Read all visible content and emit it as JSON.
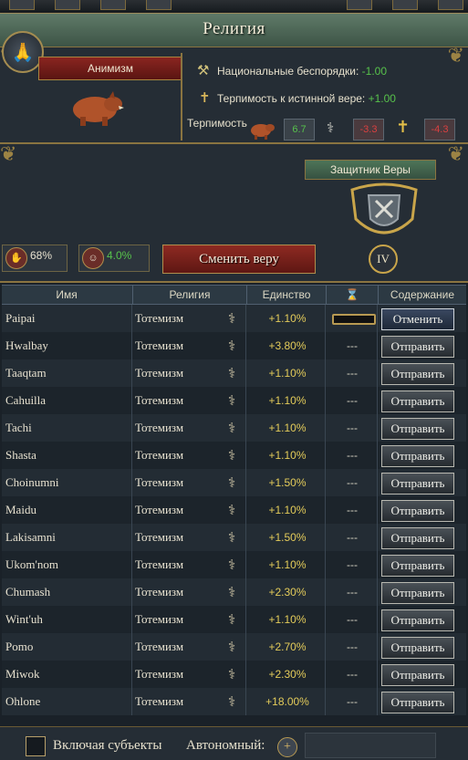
{
  "window": {
    "title": "Религия"
  },
  "religion": {
    "name": "Анимизм",
    "national_unrest_label": "Национальные беспорядки:",
    "national_unrest_value": "-1.00",
    "true_faith_tolerance_label": "Терпимость к истинной вере:",
    "true_faith_tolerance_value": "+1.00",
    "tolerance_label": "Терпимость",
    "tolerance_values": [
      "6.7",
      "-3.3",
      "-4.3"
    ]
  },
  "defender": {
    "label": "Защитник Веры",
    "rank": "IV"
  },
  "stats": {
    "percent_a": "68%",
    "percent_b": "4.0%"
  },
  "change_button": "Сменить веру",
  "table": {
    "headers": [
      "Имя",
      "Религия",
      "Единство",
      "⌛",
      "Содержание"
    ],
    "rows": [
      {
        "name": "Paipai",
        "religion": "Тотемизм",
        "unity": "+1.10%",
        "status": "bar",
        "action": "Отменить"
      },
      {
        "name": "Hwalbay",
        "religion": "Тотемизм",
        "unity": "+3.80%",
        "status": "---",
        "action": "Отправить"
      },
      {
        "name": "Taaqtam",
        "religion": "Тотемизм",
        "unity": "+1.10%",
        "status": "---",
        "action": "Отправить"
      },
      {
        "name": "Cahuilla",
        "religion": "Тотемизм",
        "unity": "+1.10%",
        "status": "---",
        "action": "Отправить"
      },
      {
        "name": "Tachi",
        "religion": "Тотемизм",
        "unity": "+1.10%",
        "status": "---",
        "action": "Отправить"
      },
      {
        "name": "Shasta",
        "religion": "Тотемизм",
        "unity": "+1.10%",
        "status": "---",
        "action": "Отправить"
      },
      {
        "name": "Choinumni",
        "religion": "Тотемизм",
        "unity": "+1.50%",
        "status": "---",
        "action": "Отправить"
      },
      {
        "name": "Maidu",
        "religion": "Тотемизм",
        "unity": "+1.10%",
        "status": "---",
        "action": "Отправить"
      },
      {
        "name": "Lakisamni",
        "religion": "Тотемизм",
        "unity": "+1.50%",
        "status": "---",
        "action": "Отправить"
      },
      {
        "name": "Ukom'nom",
        "religion": "Тотемизм",
        "unity": "+1.10%",
        "status": "---",
        "action": "Отправить"
      },
      {
        "name": "Chumash",
        "religion": "Тотемизм",
        "unity": "+2.30%",
        "status": "---",
        "action": "Отправить"
      },
      {
        "name": "Wint'uh",
        "religion": "Тотемизм",
        "unity": "+1.10%",
        "status": "---",
        "action": "Отправить"
      },
      {
        "name": "Pomo",
        "religion": "Тотемизм",
        "unity": "+2.70%",
        "status": "---",
        "action": "Отправить"
      },
      {
        "name": "Miwok",
        "religion": "Тотемизм",
        "unity": "+2.30%",
        "status": "---",
        "action": "Отправить"
      },
      {
        "name": "Ohlone",
        "religion": "Тотемизм",
        "unity": "+18.00%",
        "status": "---",
        "action": "Отправить"
      }
    ]
  },
  "footer": {
    "include_subjects": "Включая субъекты",
    "autonomous": "Автономный:"
  },
  "colors": {
    "banner_red": "#8a2520",
    "banner_green": "#4e7558",
    "unity_yellow": "#e4cc5a",
    "positive_green": "#57c24b",
    "negative_red": "#d94040",
    "gold_trim": "#8a7440"
  }
}
